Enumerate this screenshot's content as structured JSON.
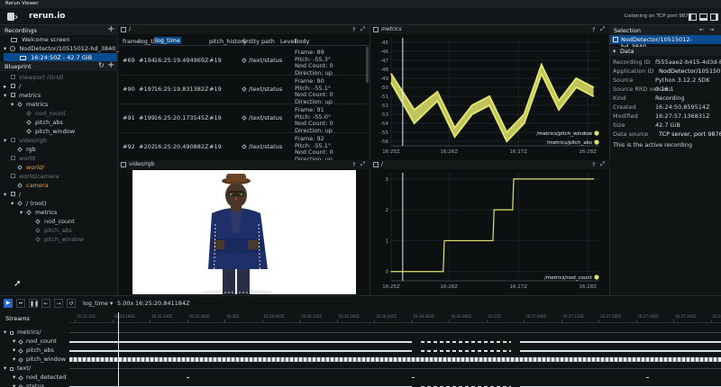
{
  "window": {
    "title": "Rerun Viewer"
  },
  "topbar": {
    "app_name": "rerun.io",
    "status": "Listening on TCP port 9876"
  },
  "recordings": {
    "title": "Recordings",
    "items": [
      {
        "label": "Welcome screen"
      },
      {
        "label": "NodDetector/10515012-hd_3840_2160_..."
      },
      {
        "label": "16:24:50Z - 42.7 GiB"
      }
    ]
  },
  "blueprint": {
    "title": "Blueprint",
    "items": [
      {
        "label": "Viewport (Grid)"
      },
      {
        "label": "/"
      },
      {
        "label": "metrics"
      },
      {
        "label": "metrics"
      },
      {
        "label": "nod_count"
      },
      {
        "label": "pitch_abs"
      },
      {
        "label": "pitch_window"
      },
      {
        "label": "video/rgb"
      },
      {
        "label": "rgb"
      },
      {
        "label": "world"
      },
      {
        "label": "world/"
      },
      {
        "label": "world/camera"
      },
      {
        "label": "camera"
      },
      {
        "label": "/"
      },
      {
        "label": "/ (root)"
      },
      {
        "label": "metrics"
      },
      {
        "label": "nod_count"
      },
      {
        "label": "pitch_abs"
      },
      {
        "label": "pitch_window"
      }
    ]
  },
  "table_view": {
    "title": "/",
    "columns": [
      "frame",
      "log_ti",
      "log_time",
      "pitch_history",
      "Entity path",
      "Level",
      "Body"
    ],
    "rows": [
      {
        "frame": "#69",
        "log_tick": "#194",
        "log_time": "16:25:19.494969Z",
        "pitch_history": "#19",
        "entity": "/text/status",
        "level": "-",
        "body": [
          "Frame: 89",
          "Pitch: -55.3°",
          "Nod Count: 0",
          "Direction: up"
        ]
      },
      {
        "frame": "#90",
        "log_tick": "#197",
        "log_time": "16:25:19.831382Z",
        "pitch_history": "#19",
        "entity": "/text/status",
        "level": "-",
        "body": [
          "Frame: 90",
          "Pitch: -55.1°",
          "Nod Count: 0",
          "Direction: up"
        ]
      },
      {
        "frame": "#91",
        "log_tick": "#199",
        "log_time": "16:25:20.173545Z",
        "pitch_history": "#19",
        "entity": "/text/status",
        "level": "-",
        "body": [
          "Frame: 91",
          "Pitch: -55.0°",
          "Nod Count: 0",
          "Direction: up"
        ]
      },
      {
        "frame": "#92",
        "log_tick": "#202",
        "log_time": "16:25:20.490882Z",
        "pitch_history": "#19",
        "entity": "/text/status",
        "level": "-",
        "body": [
          "Frame: 92",
          "Pitch: -55.1°",
          "Nod Count: 0",
          "Direction: up"
        ]
      }
    ]
  },
  "metrics_plot": {
    "title": "metrics",
    "y_ticks": [
      "-45",
      "-46",
      "-47",
      "-48",
      "-49",
      "-50",
      "-51",
      "-52",
      "-53",
      "-54",
      "-55",
      "-56"
    ],
    "x_ticks": [
      "16:25Z",
      "16:26Z",
      "16:27Z",
      "16:28Z"
    ],
    "legend": [
      "/metrics/pitch_window",
      "/metrics/pitch_abs"
    ],
    "series_color": "#e0e36a"
  },
  "video_view": {
    "title": "video/rgb"
  },
  "nod_plot": {
    "title": "/",
    "y_ticks": [
      "3",
      "2",
      "1",
      "0"
    ],
    "x_ticks": [
      "16:25Z",
      "16:26Z",
      "16:27Z",
      "16:28Z"
    ],
    "legend": [
      "/metrics/nod_count"
    ],
    "series_color": "#e0e36a"
  },
  "chart_data": [
    {
      "type": "line",
      "title": "metrics",
      "series": [
        {
          "name": "/metrics/pitch_window",
          "x": [
            "16:25:10Z",
            "16:25:30Z",
            "16:25:50Z",
            "16:26:05Z",
            "16:26:20Z",
            "16:26:35Z",
            "16:26:50Z",
            "16:27:05Z",
            "16:27:20Z",
            "16:27:35Z",
            "16:27:50Z",
            "16:28:05Z"
          ],
          "values": [
            -48.5,
            -52.5,
            -50.5,
            -54.5,
            -52,
            -51,
            -55,
            -53,
            -47.5,
            -51.5,
            -49,
            -50
          ]
        },
        {
          "name": "/metrics/pitch_abs",
          "x": [
            "16:25:10Z",
            "16:25:30Z",
            "16:25:50Z",
            "16:26:05Z",
            "16:26:20Z",
            "16:26:35Z",
            "16:26:50Z",
            "16:27:05Z",
            "16:27:20Z",
            "16:27:35Z",
            "16:27:50Z",
            "16:28:05Z"
          ],
          "values": [
            -49.5,
            -54,
            -51.5,
            -55.5,
            -53,
            -52,
            -56,
            -54,
            -48.5,
            -52.5,
            -50,
            -51
          ]
        }
      ],
      "ylim": [
        -56.5,
        -44.5
      ]
    },
    {
      "type": "line",
      "title": "/",
      "series": [
        {
          "name": "/metrics/nod_count",
          "x": [
            "16:25:10Z",
            "16:25:55Z",
            "16:25:56Z",
            "16:26:38Z",
            "16:26:39Z",
            "16:26:55Z",
            "16:26:56Z",
            "16:28:05Z"
          ],
          "values": [
            0,
            0,
            1,
            1,
            2,
            2,
            3,
            3
          ]
        }
      ],
      "ylim": [
        -0.3,
        3.2
      ]
    }
  ],
  "selection": {
    "title": "Selection",
    "item": "NodDetector/10515012-hd_3840...",
    "section": "Data",
    "fields": [
      {
        "k": "Recording ID",
        "v": "f555aae2-b415-4d3d-8d8..."
      },
      {
        "k": "Application ID",
        "v": "NodDetector/10515012-h..."
      },
      {
        "k": "Source",
        "v": "Python 3.12.2 SDK"
      },
      {
        "k": "Source RRD version",
        "v": "0.16.1"
      },
      {
        "k": "Kind",
        "v": "Recording"
      },
      {
        "k": "Created",
        "v": "16:24:50.859514Z"
      },
      {
        "k": "Modified",
        "v": "16:27:57.136831Z"
      },
      {
        "k": "Size",
        "v": "42.7 GiB"
      },
      {
        "k": "Data source",
        "v": "TCP server, port 9876"
      }
    ],
    "note": "This is the active recording"
  },
  "timeline": {
    "timeline_name": "log_time",
    "speed": "5.00x",
    "current_time": "16:25:20.841184Z",
    "streams_title": "Streams",
    "ticks": [
      "16:25:10Z",
      "16:25:180Z",
      "16:25:240Z",
      "16:25:300Z",
      "16:26Z",
      "16:26:060Z",
      "16:26:120Z",
      "16:26:180Z",
      "16:26:240Z",
      "16:26:300Z",
      "16:26:360Z",
      "16:27Z",
      "16:27:060Z",
      "16:27:120Z",
      "16:27:180Z",
      "16:27:240Z",
      "16:27:300Z",
      "16:28Z"
    ],
    "streams": [
      {
        "label": "metrics/"
      },
      {
        "label": "nod_count"
      },
      {
        "label": "pitch_abs"
      },
      {
        "label": "pitch_window"
      },
      {
        "label": "text/"
      },
      {
        "label": "nod_detected"
      },
      {
        "label": "status"
      }
    ]
  }
}
